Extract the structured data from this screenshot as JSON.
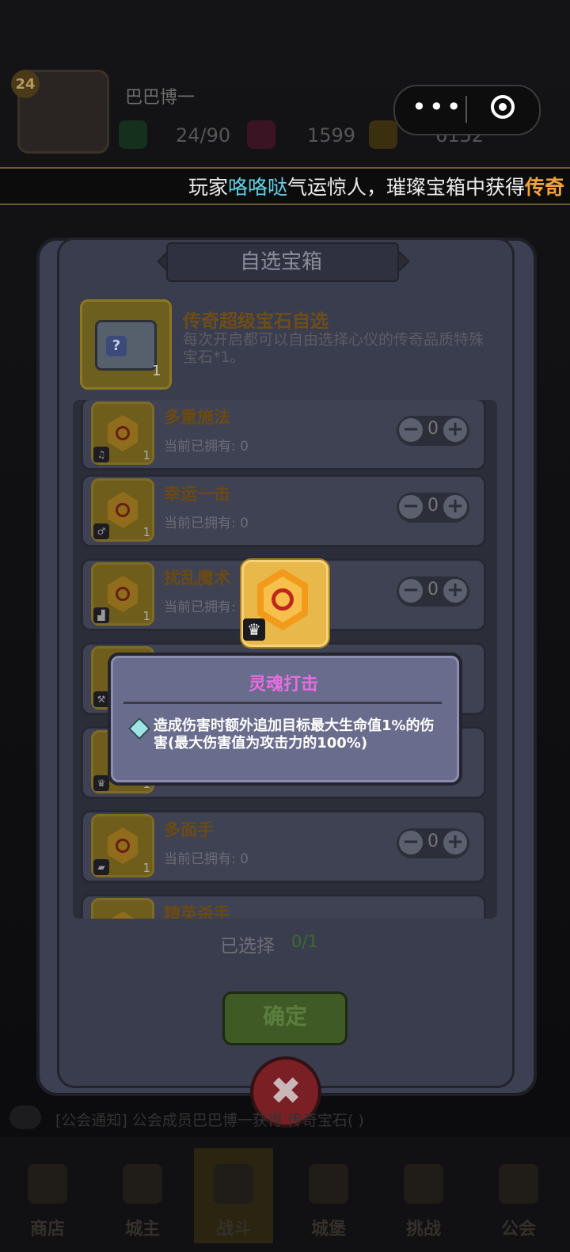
{
  "app": {
    "player_name": "巴巴博一",
    "level": "24",
    "stamina": "24/90",
    "gems": "1599",
    "gold": "6152"
  },
  "capsule": {
    "more_icon": "more-dots-icon",
    "close_icon": "target-icon"
  },
  "marquee": {
    "prefix": "玩家",
    "name": "咯咯哒",
    "middle": "气运惊人，璀璨宝箱中获得",
    "tail": "传奇"
  },
  "modal": {
    "title": "自选宝箱",
    "chest": {
      "name": "传奇超级宝石自选",
      "desc": "每次开启都可以自由选择心仪的传奇品质特殊宝石*1。",
      "count": "1",
      "badge": "?"
    },
    "items": [
      {
        "name": "多重施法",
        "owned_label": "当前已拥有:",
        "owned": "0",
        "qty": "0",
        "count": "1"
      },
      {
        "name": "幸运一击",
        "owned_label": "当前已拥有:",
        "owned": "0",
        "qty": "0",
        "count": "1"
      },
      {
        "name": "扰乱魔术",
        "owned_label": "当前已拥有:",
        "owned": "",
        "qty": "0",
        "count": "1"
      },
      {
        "name": "",
        "owned_label": "",
        "owned": "",
        "qty": "",
        "count": ""
      },
      {
        "name": "",
        "owned_label": "",
        "owned": "",
        "qty": "",
        "count": "1"
      },
      {
        "name": "多面手",
        "owned_label": "当前已拥有:",
        "owned": "0",
        "qty": "0",
        "count": "1"
      },
      {
        "name": "精英杀手",
        "owned_label": "",
        "owned": "",
        "qty": "",
        "count": ""
      }
    ],
    "selected_label": "已选择",
    "selected_value": "0/1",
    "confirm": "确定",
    "close": "✖"
  },
  "tooltip": {
    "title": "灵魂打击",
    "desc": "造成伤害时额外追加目标最大生命值1%的伤害(最大伤害值为攻击力的100%)"
  },
  "notice": {
    "text": "[公会通知] 公会成员巴巴博一获得 传奇宝石( )"
  },
  "nav": [
    {
      "label": "商店"
    },
    {
      "label": "城主"
    },
    {
      "label": "战斗"
    },
    {
      "label": "城堡"
    },
    {
      "label": "挑战"
    },
    {
      "label": "公会"
    }
  ],
  "colors": {
    "accent_gold": "#f2a33a",
    "name_cyan": "#5fd3e6",
    "tooltip_title": "#e56ee0"
  }
}
